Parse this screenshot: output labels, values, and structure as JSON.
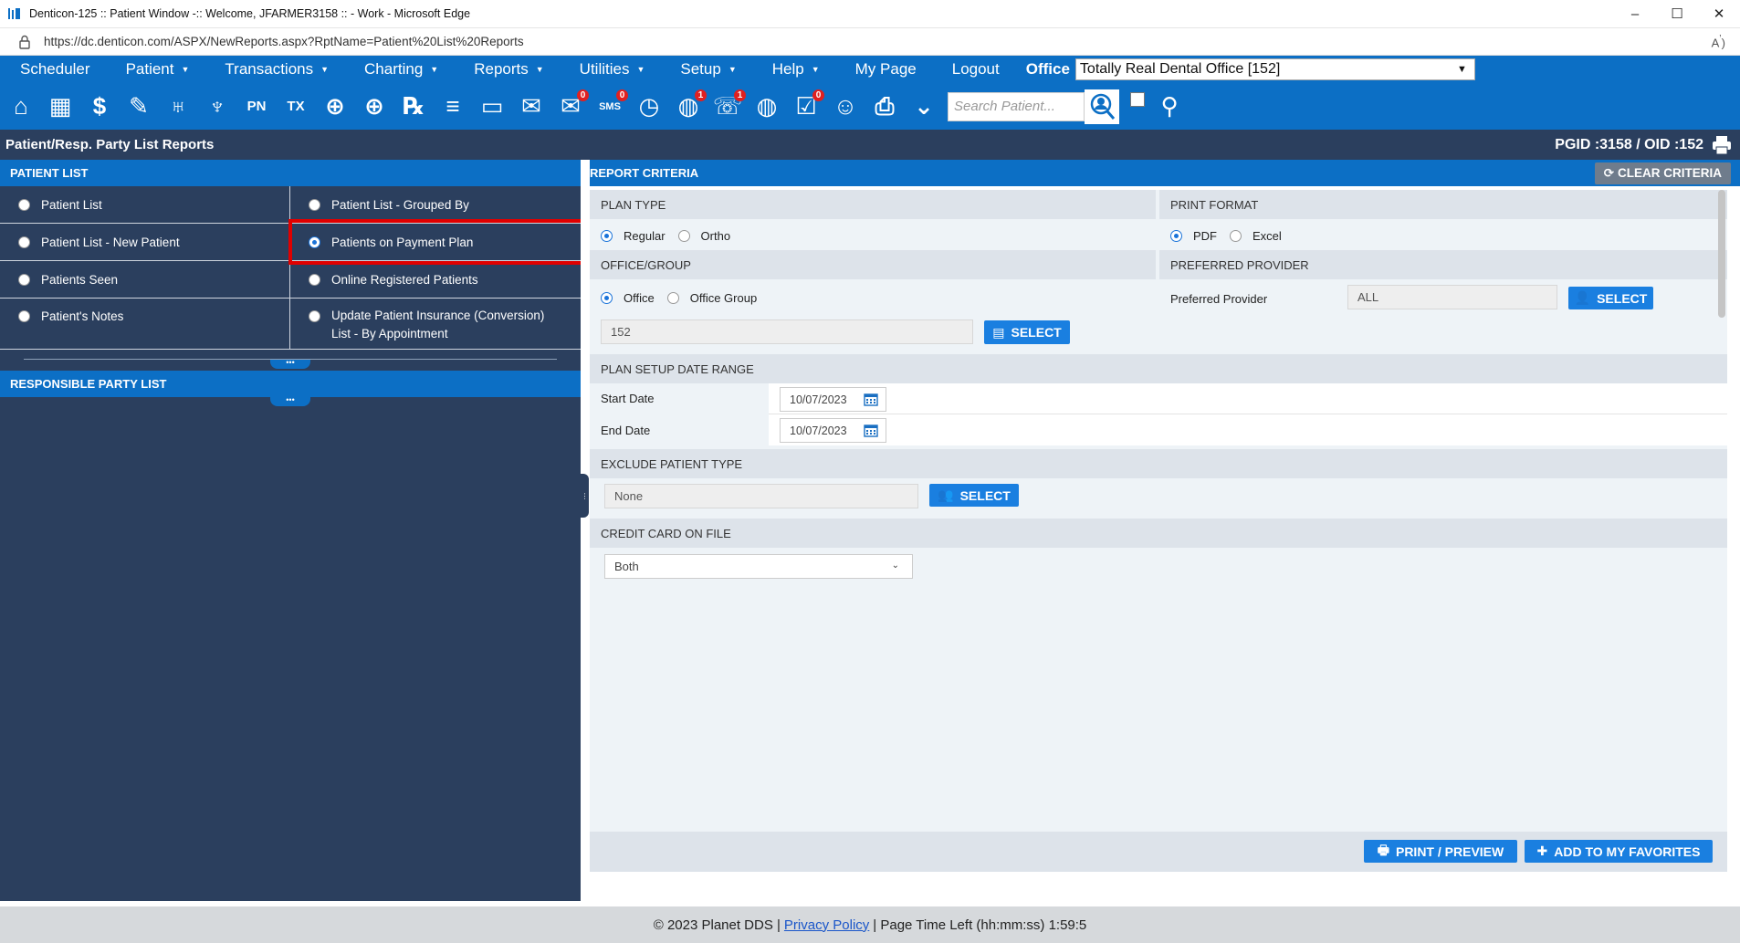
{
  "window": {
    "title": "Denticon-125 :: Patient Window -:: Welcome, JFARMER3158 :: - Work - Microsoft Edge",
    "controls": [
      "–",
      "☐",
      "✕"
    ]
  },
  "address": {
    "url": "https://dc.denticon.com/ASPX/NewReports.aspx?RptName=Patient%20List%20Reports"
  },
  "menu": {
    "items": [
      {
        "label": "Scheduler",
        "caret": false
      },
      {
        "label": "Patient",
        "caret": true
      },
      {
        "label": "Transactions",
        "caret": true
      },
      {
        "label": "Charting",
        "caret": true
      },
      {
        "label": "Reports",
        "caret": true
      },
      {
        "label": "Utilities",
        "caret": true
      },
      {
        "label": "Setup",
        "caret": true
      },
      {
        "label": "Help",
        "caret": true
      },
      {
        "label": "My Page",
        "caret": false
      },
      {
        "label": "Logout",
        "caret": false
      }
    ],
    "office_label": "Office",
    "office_value": "Totally Real Dental Office [152]"
  },
  "toolbar": {
    "search_placeholder": "Search Patient...",
    "icons": [
      {
        "name": "home-icon",
        "badge": ""
      },
      {
        "name": "calendar-icon",
        "badge": ""
      },
      {
        "name": "dollar-icon",
        "badge": ""
      },
      {
        "name": "edit-list-icon",
        "badge": ""
      },
      {
        "name": "tooth-icon",
        "badge": ""
      },
      {
        "name": "tooth-roots-icon",
        "badge": ""
      },
      {
        "name": "pn-icon",
        "badge": ""
      },
      {
        "name": "tx-icon",
        "badge": ""
      },
      {
        "name": "add-patient-icon",
        "badge": ""
      },
      {
        "name": "patient-group-add-icon",
        "badge": ""
      },
      {
        "name": "rx-icon",
        "badge": ""
      },
      {
        "name": "notes-icon",
        "badge": ""
      },
      {
        "name": "scanner-icon",
        "badge": ""
      },
      {
        "name": "mail-icon",
        "badge": ""
      },
      {
        "name": "message-icon",
        "badge": "0"
      },
      {
        "name": "sms-icon",
        "badge": "0"
      },
      {
        "name": "clock-icon",
        "badge": ""
      },
      {
        "name": "globe-user-icon",
        "badge": "1"
      },
      {
        "name": "support-icon",
        "badge": "1"
      },
      {
        "name": "globe-icon",
        "badge": ""
      },
      {
        "name": "checklist-icon",
        "badge": "0"
      },
      {
        "name": "family-icon",
        "badge": ""
      },
      {
        "name": "printer-icon",
        "badge": ""
      },
      {
        "name": "chevron-down-box-icon",
        "badge": ""
      }
    ]
  },
  "page_header": {
    "title": "Patient/Resp. Party List Reports",
    "ids": "PGID :3158  /  OID :152"
  },
  "left": {
    "patient_list_header": "PATIENT LIST",
    "options": [
      {
        "label": "Patient List",
        "selected": false
      },
      {
        "label": "Patient List - Grouped By",
        "selected": false
      },
      {
        "label": "Patient List - New Patient",
        "selected": false
      },
      {
        "label": "Patients on Payment Plan",
        "selected": true
      },
      {
        "label": "Patients Seen",
        "selected": false
      },
      {
        "label": "Online Registered Patients",
        "selected": false
      },
      {
        "label": "Patient's Notes",
        "selected": false
      },
      {
        "label": "Update Patient Insurance (Conversion)",
        "label2": "List - By Appointment",
        "selected": false
      }
    ],
    "collapse_glyph": "•••",
    "resp_party_header": "RESPONSIBLE PARTY LIST"
  },
  "criteria": {
    "header": "REPORT CRITERIA",
    "clear_label": "CLEAR CRITERIA",
    "plan_type": {
      "label": "PLAN TYPE",
      "options": [
        "Regular",
        "Ortho"
      ],
      "selected": "Regular"
    },
    "print_format": {
      "label": "PRINT FORMAT",
      "options": [
        "PDF",
        "Excel"
      ],
      "selected": "PDF"
    },
    "office_group": {
      "label": "OFFICE/GROUP",
      "options": [
        "Office",
        "Office Group"
      ],
      "selected": "Office",
      "value": "152",
      "select_label": "SELECT"
    },
    "preferred_provider": {
      "label": "PREFERRED PROVIDER",
      "field_label": "Preferred Provider",
      "value": "ALL",
      "select_label": "SELECT"
    },
    "date_range": {
      "label": "PLAN SETUP DATE RANGE",
      "start_label": "Start Date",
      "start_value": "10/07/2023",
      "end_label": "End Date",
      "end_value": "10/07/2023"
    },
    "exclude": {
      "label": "EXCLUDE PATIENT TYPE",
      "value": "None",
      "select_label": "SELECT"
    },
    "credit_card": {
      "label": "CREDIT CARD ON FILE",
      "value": "Both"
    },
    "print_preview_label": "PRINT / PREVIEW",
    "favorites_label": "ADD TO MY FAVORITES"
  },
  "status": {
    "copyright": "© 2023 Planet DDS |",
    "privacy": "Privacy Policy",
    "time_left": "| Page Time Left (hh:mm:ss) 1:59:5"
  },
  "colors": {
    "brand_blue": "#0c6fc5",
    "navy": "#2b3f5e",
    "button_blue": "#1a7fe0",
    "highlight_red": "#e00000"
  }
}
